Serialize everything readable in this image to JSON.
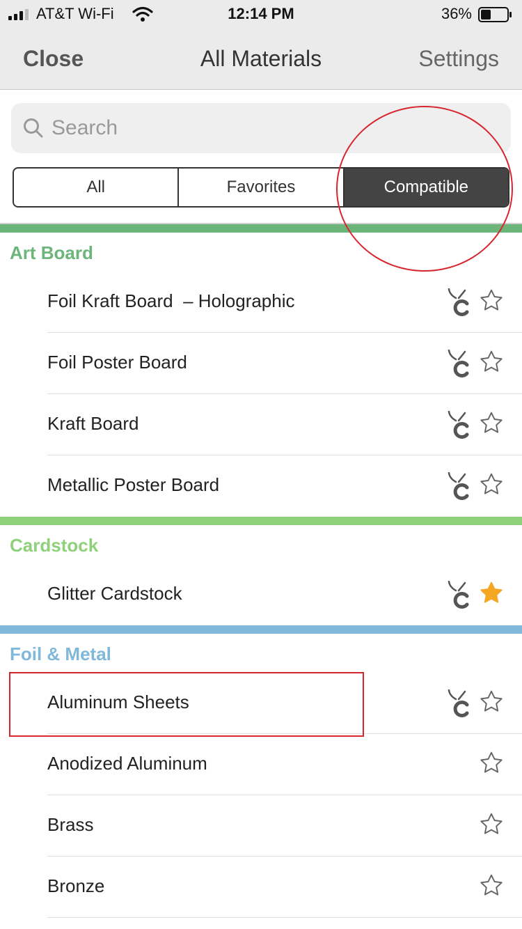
{
  "status_bar": {
    "carrier": "AT&T Wi-Fi",
    "time": "12:14 PM",
    "battery": "36%"
  },
  "nav": {
    "close": "Close",
    "title": "All Materials",
    "settings": "Settings"
  },
  "search": {
    "placeholder": "Search",
    "value": ""
  },
  "filter": {
    "all": "All",
    "favorites": "Favorites",
    "compatible": "Compatible",
    "selected": "Compatible"
  },
  "colors": {
    "art_board": "#6bb57b",
    "cardstock": "#8fd17a",
    "foil_metal": "#7fb8d9",
    "favorite_star": "#f5a623",
    "annotation": "#d8262e"
  },
  "sections": [
    {
      "title": "Art Board",
      "items": [
        {
          "name": "Foil Kraft Board  – Holographic",
          "compatible": true,
          "favorite": false
        },
        {
          "name": "Foil Poster Board",
          "compatible": true,
          "favorite": false
        },
        {
          "name": "Kraft Board",
          "compatible": true,
          "favorite": false
        },
        {
          "name": "Metallic Poster Board",
          "compatible": true,
          "favorite": false
        }
      ]
    },
    {
      "title": "Cardstock",
      "items": [
        {
          "name": "Glitter Cardstock",
          "compatible": true,
          "favorite": true
        }
      ]
    },
    {
      "title": "Foil & Metal",
      "items": [
        {
          "name": "Aluminum Sheets",
          "compatible": true,
          "favorite": false
        },
        {
          "name": "Anodized Aluminum",
          "compatible": false,
          "favorite": false
        },
        {
          "name": "Brass",
          "compatible": false,
          "favorite": false
        },
        {
          "name": "Bronze",
          "compatible": false,
          "favorite": false
        }
      ]
    }
  ]
}
